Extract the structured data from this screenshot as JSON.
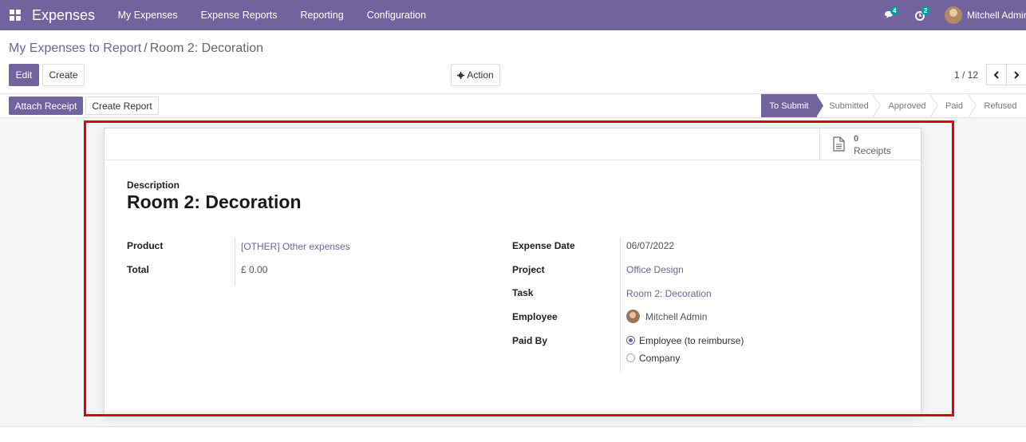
{
  "navbar": {
    "brand": "Expenses",
    "menu": [
      "My Expenses",
      "Expense Reports",
      "Reporting",
      "Configuration"
    ],
    "messages_badge": "4",
    "activities_badge": "2",
    "user": "Mitchell Admin"
  },
  "breadcrumb": {
    "parent": "My Expenses to Report",
    "separator": "/",
    "current": "Room 2: Decoration"
  },
  "buttons": {
    "edit": "Edit",
    "create": "Create",
    "action": "Action",
    "attach_receipt": "Attach Receipt",
    "create_report": "Create Report"
  },
  "pager": {
    "value": "1 / 12"
  },
  "status_stages": [
    "To Submit",
    "Submitted",
    "Approved",
    "Paid",
    "Refused"
  ],
  "status_active": "To Submit",
  "receipts": {
    "count": "0",
    "label": "Receipts"
  },
  "form": {
    "description_label": "Description",
    "title": "Room 2: Decoration",
    "product_label": "Product",
    "product_value": "[OTHER] Other expenses",
    "total_label": "Total",
    "total_value": "£ 0.00",
    "expense_date_label": "Expense Date",
    "expense_date_value": "06/07/2022",
    "project_label": "Project",
    "project_value": "Office Design",
    "task_label": "Task",
    "task_value": "Room 2: Decoration",
    "employee_label": "Employee",
    "employee_value": "Mitchell Admin",
    "paid_by_label": "Paid By",
    "paid_by_options": [
      "Employee (to reimburse)",
      "Company"
    ],
    "paid_by_selected": "Employee (to reimburse)"
  },
  "colors": {
    "brand": "#71639e",
    "highlight": "#e3000f"
  }
}
